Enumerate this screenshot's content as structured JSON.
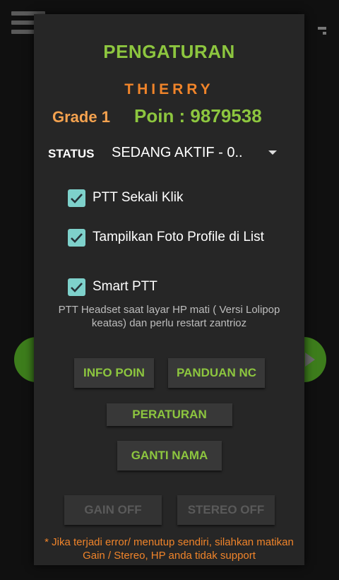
{
  "dialog": {
    "title": "PENGATURAN",
    "username": "THIERRY",
    "grade": "Grade 1",
    "points": "Poin : 9879538",
    "status": {
      "label": "STATUS",
      "value": "SEDANG AKTIF - 0.."
    },
    "options": [
      {
        "label": "PTT  Sekali Klik",
        "checked": true
      },
      {
        "label": "Tampilkan Foto Profile di List",
        "checked": true
      },
      {
        "label": "Smart PTT",
        "checked": true
      }
    ],
    "smart_ptt_note": "PTT Headset saat layar HP mati ( Versi Lolipop keatas)  dan perlu restart zantrioz",
    "buttons": {
      "info_poin": "INFO POIN",
      "panduan_nc": "PANDUAN NC",
      "peraturan": "PERATURAN",
      "ganti_nama": "GANTI NAMA",
      "gain_off": "GAIN OFF",
      "stereo_off": "STEREO OFF"
    },
    "footer_note": "* Jika terjadi error/ menutup sendiri, silahkan matikan Gain / Stereo, HP anda tidak support"
  },
  "colors": {
    "accent_green": "#8dc63f",
    "accent_orange": "#f0842a",
    "checkbox": "#7ed1cb",
    "dialog_bg": "#262626"
  },
  "icons": {
    "menu": "hamburger-menu-icon",
    "overflow": "overflow-icon",
    "check": "checkmark-icon",
    "dropdown": "chevron-down-icon",
    "next": "chevron-right-icon"
  }
}
